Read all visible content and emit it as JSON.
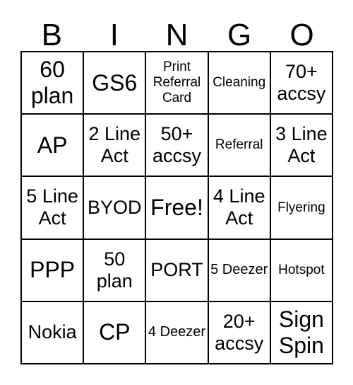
{
  "header": [
    "B",
    "I",
    "N",
    "G",
    "O"
  ],
  "cells": [
    "60 plan",
    "GS6",
    "Print Referral Card",
    "Cleaning",
    "70+ accsy",
    "AP",
    "2 Line Act",
    "50+ accsy",
    "Referral",
    "3 Line Act",
    "5 Line Act",
    "BYOD",
    "Free!",
    "4 Line Act",
    "Flyering",
    "PPP",
    "50 plan",
    "PORT",
    "5 Deezer",
    "Hotspot",
    "Nokia",
    "CP",
    "4 Deezer",
    "20+ accsy",
    "Sign Spin"
  ]
}
